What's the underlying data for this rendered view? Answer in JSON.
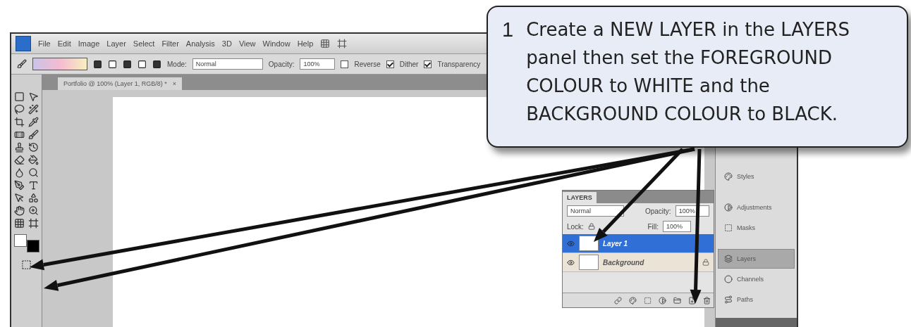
{
  "callout": {
    "number": "1",
    "text": "Create a NEW LAYER in the LAYERS panel then set the FOREGROUND COLOUR to WHITE and the BACKGROUND COLOUR to BLACK."
  },
  "menu_bar": {
    "items": [
      "File",
      "Edit",
      "Image",
      "Layer",
      "Select",
      "Filter",
      "Analysis",
      "3D",
      "View",
      "Window",
      "Help"
    ]
  },
  "options_bar": {
    "mode_label": "Mode:",
    "mode_value": "Normal",
    "opacity_label": "Opacity:",
    "opacity_value": "100%",
    "checkboxes": [
      {
        "label": "Reverse",
        "checked": false
      },
      {
        "label": "Dither",
        "checked": true
      },
      {
        "label": "Transparency",
        "checked": true
      }
    ]
  },
  "document_tab": {
    "title": "Portfolio @ 100% (Layer 1, RGB/8) *",
    "close": "×"
  },
  "color_swatches": [
    {
      "kind": "foreground",
      "color": "#ffffff"
    },
    {
      "kind": "background",
      "color": "#000000"
    }
  ],
  "layers_panel": {
    "tab": "LAYERS",
    "blend_mode": "Normal",
    "opacity_label": "Opacity:",
    "opacity_value": "100%",
    "lock_label": "Lock:",
    "fill_label": "Fill:",
    "fill_value": "100%",
    "layers": [
      {
        "name": "Layer 1",
        "selected": true,
        "locked": false
      },
      {
        "name": "Background",
        "selected": false,
        "locked": true
      }
    ]
  },
  "dock": {
    "items": [
      {
        "label": "Styles",
        "selected": false
      },
      {
        "label": "Adjustments",
        "selected": false
      },
      {
        "label": "Masks",
        "selected": false
      },
      {
        "label": "Layers",
        "selected": true
      },
      {
        "label": "Channels",
        "selected": false
      },
      {
        "label": "Paths",
        "selected": false
      }
    ]
  }
}
